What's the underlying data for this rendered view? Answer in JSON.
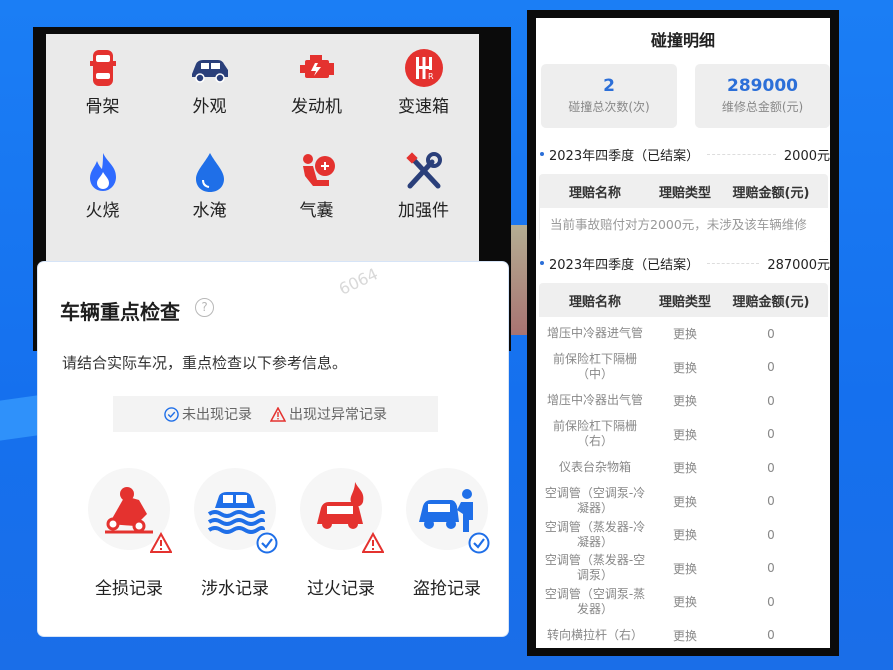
{
  "inspect_grid": [
    {
      "label": "骨架",
      "icon": "car-frame-icon"
    },
    {
      "label": "外观",
      "icon": "car-exterior-icon"
    },
    {
      "label": "发动机",
      "icon": "engine-icon"
    },
    {
      "label": "变速箱",
      "icon": "gearbox-icon"
    },
    {
      "label": "火烧",
      "icon": "fire-icon"
    },
    {
      "label": "水淹",
      "icon": "water-drop-icon"
    },
    {
      "label": "气囊",
      "icon": "airbag-icon"
    },
    {
      "label": "加强件",
      "icon": "tools-icon"
    }
  ],
  "check": {
    "title": "车辆重点检查",
    "help_icon": "?",
    "tip": "请结合实际车况，重点检查以下参考信息。",
    "legend_ok": "未出现记录",
    "legend_warn": "出现过异常记录",
    "watermark": "6064",
    "records": [
      {
        "label": "全损记录",
        "status": "warn",
        "icon": "total-loss-icon"
      },
      {
        "label": "涉水记录",
        "status": "ok",
        "icon": "flood-icon"
      },
      {
        "label": "过火记录",
        "status": "warn",
        "icon": "fire-car-icon"
      },
      {
        "label": "盗抢记录",
        "status": "ok",
        "icon": "theft-icon"
      }
    ]
  },
  "detail": {
    "title": "碰撞明细",
    "count_value": "2",
    "count_label": "碰撞总次数(次)",
    "amount_value": "289000",
    "amount_label": "维修总金额(元)",
    "col_name": "理赔名称",
    "col_type": "理赔类型",
    "col_amount": "理赔金额(元)",
    "case1": {
      "period": "2023年四季度（已结案）",
      "amount": "2000元",
      "note": "当前事故赔付对方2000元，未涉及该车辆维修"
    },
    "case2": {
      "period": "2023年四季度（已结案）",
      "amount": "287000元"
    },
    "rows": [
      {
        "name": "增压中冷器进气管",
        "type": "更换",
        "amount": "0"
      },
      {
        "name": "前保险杠下隔栅（中）",
        "type": "更换",
        "amount": "0"
      },
      {
        "name": "增压中冷器出气管",
        "type": "更换",
        "amount": "0"
      },
      {
        "name": "前保险杠下隔栅（右）",
        "type": "更换",
        "amount": "0"
      },
      {
        "name": "仪表台杂物箱",
        "type": "更换",
        "amount": "0"
      },
      {
        "name": "空调管（空调泵-冷凝器）",
        "type": "更换",
        "amount": "0"
      },
      {
        "name": "空调管（蒸发器-冷凝器）",
        "type": "更换",
        "amount": "0"
      },
      {
        "name": "空调管（蒸发器-空调泵）",
        "type": "更换",
        "amount": "0"
      },
      {
        "name": "空调管（空调泵-蒸发器）",
        "type": "更换",
        "amount": "0"
      },
      {
        "name": "转向横拉杆（右）",
        "type": "更换",
        "amount": "0"
      }
    ]
  },
  "colors": {
    "accent": "#2c6fd8",
    "red": "#e4322f",
    "navy": "#2a3f7a",
    "blue": "#1f6fe8"
  }
}
